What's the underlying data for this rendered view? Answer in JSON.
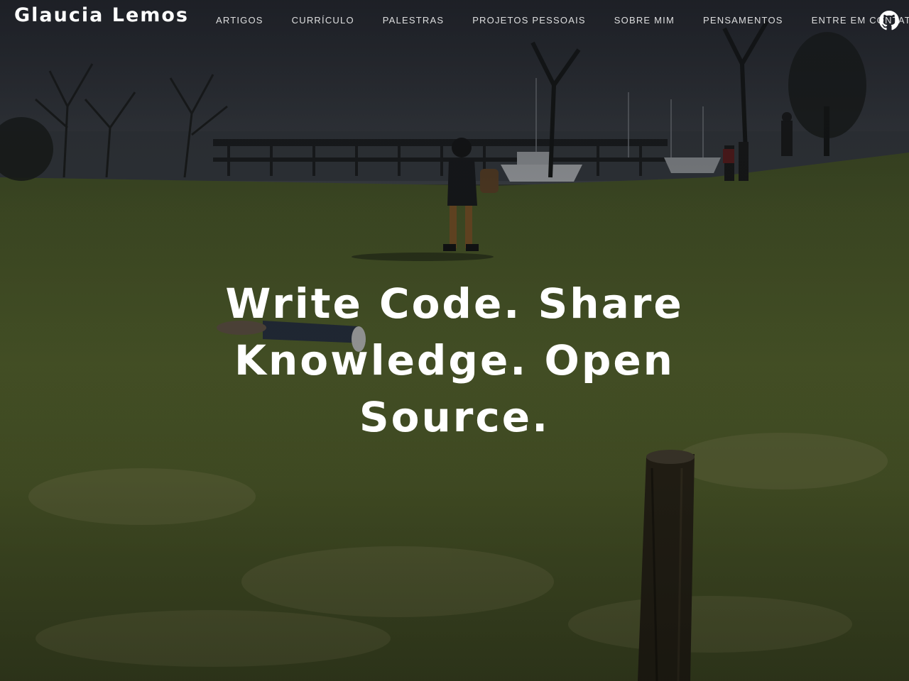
{
  "brand": {
    "name": "Glaucia Lemos"
  },
  "nav": {
    "items": [
      {
        "label": "ARTIGOS"
      },
      {
        "label": "CURRÍCULO"
      },
      {
        "label": "PALESTRAS"
      },
      {
        "label": "PROJETOS PESSOAIS"
      },
      {
        "label": "SOBRE MIM"
      },
      {
        "label": "PENSAMENTOS"
      },
      {
        "label": "ENTRE EM CONTATO"
      }
    ],
    "github_icon": "github-icon"
  },
  "hero": {
    "headline": "Write Code. Share Knowledge. Open Source.",
    "background": "park-lawn-photo"
  },
  "colors": {
    "text": "#ffffff",
    "grass": "#5a6b2e",
    "sky": "#2a2d33"
  }
}
